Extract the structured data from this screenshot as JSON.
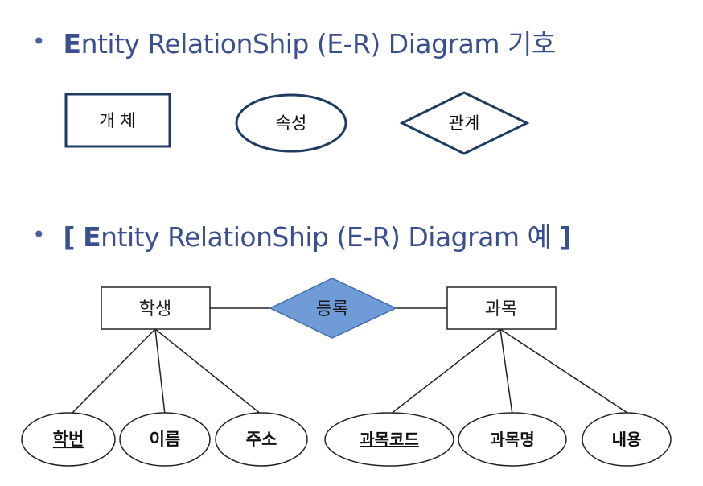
{
  "heading1": {
    "bullet": "•",
    "text_first": "E",
    "text_rest": "ntity RelationShip (E-R) Diagram 기호"
  },
  "heading2": {
    "bullet": "•",
    "open_bracket": "[",
    "text_first": "E",
    "text_rest": "ntity RelationShip (E-R) Diagram 예",
    "close_bracket": "]"
  },
  "legend": {
    "entity": "개 체",
    "attribute": "속성",
    "relationship": "관계"
  },
  "example": {
    "entity_left": "학생",
    "relationship": "등록",
    "entity_right": "과목",
    "left_attributes": [
      {
        "label": "학번",
        "key": true
      },
      {
        "label": "이름",
        "key": false
      },
      {
        "label": "주소",
        "key": false
      }
    ],
    "right_attributes": [
      {
        "label": "과목코드",
        "key": true
      },
      {
        "label": "과목명",
        "key": false
      },
      {
        "label": "내용",
        "key": false
      }
    ]
  },
  "colors": {
    "heading": "#3a4f8f",
    "legend_stroke": "#1f3b63",
    "relationship_fill": "#6f9bd6",
    "example_stroke": "#222222"
  }
}
